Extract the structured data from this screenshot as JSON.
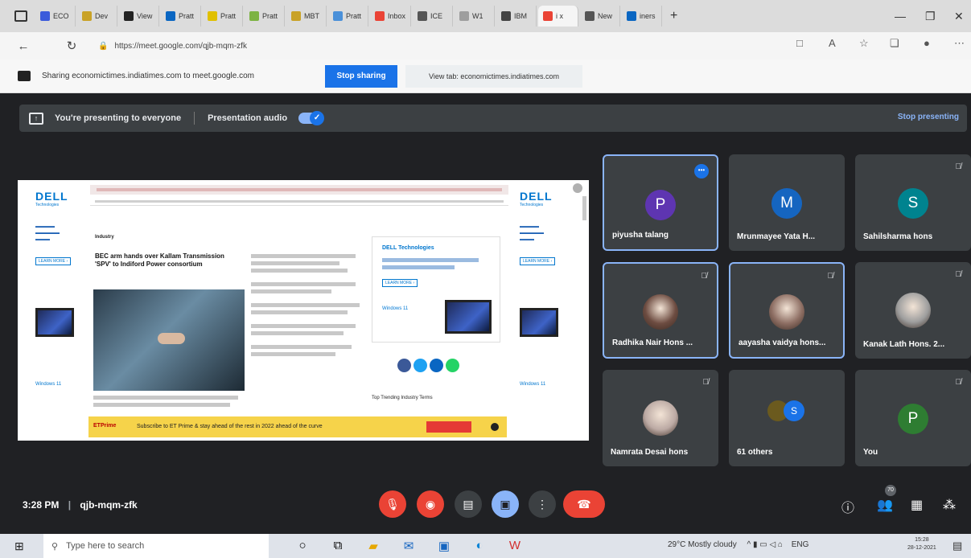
{
  "browser": {
    "tabs": [
      {
        "label": "ECO",
        "color": "#3b5bdb"
      },
      {
        "label": "Dev",
        "color": "#c9a227"
      },
      {
        "label": "View",
        "color": "#222222"
      },
      {
        "label": "Pratt",
        "color": "#0a66c2"
      },
      {
        "label": "Pratt",
        "color": "#e0c000"
      },
      {
        "label": "Pratt",
        "color": "#7cb342"
      },
      {
        "label": "MBT",
        "color": "#c9a227"
      },
      {
        "label": "Pratt",
        "color": "#4a90d9"
      },
      {
        "label": "Inbox",
        "color": "#ea4335"
      },
      {
        "label": "ICE",
        "color": "#555555"
      },
      {
        "label": "W1",
        "color": "#9e9e9e"
      },
      {
        "label": "IBM",
        "color": "#444444"
      },
      {
        "label": "i x",
        "color": "#ea4335",
        "active": true
      },
      {
        "label": "New",
        "color": "#555555"
      },
      {
        "label": "iners",
        "color": "#0a66c2"
      }
    ],
    "url": "https://meet.google.com/qjb-mqm-zfk",
    "window_controls": {
      "minimize": "—",
      "restore": "❐",
      "close": "✕"
    }
  },
  "sharebar": {
    "text": "Sharing economictimes.indiatimes.com to meet.google.com",
    "stop_label": "Stop sharing",
    "view_label": "View tab: economictimes.indiatimes.com"
  },
  "presenting": {
    "text": "You're presenting to everyone",
    "audio_label": "Presentation audio",
    "stop_label": "Stop presenting"
  },
  "shared_page": {
    "brand": "DELL",
    "brand_sub": "Technologies",
    "section": "Industry",
    "headline": "BEC arm hands over Kallam Transmission 'SPV' to Indiford Power consortium",
    "ad_title": "DELL Technologies",
    "ad_os": "Windows 11",
    "learn_more": "LEARN MORE ›",
    "trending": "Top Trending Industry Terms",
    "banner_brand": "ETPrime",
    "banner_text": "Subscribe to ET Prime & stay ahead of the rest in 2022 ahead of the curve"
  },
  "participants": [
    {
      "name": "piyusha talang",
      "initial": "P",
      "color": "#5e35b1",
      "type": "initial",
      "speaking": true,
      "more": true
    },
    {
      "name": "Mrunmayee Yata H...",
      "initial": "M",
      "color": "#1565c0",
      "type": "initial",
      "speaking": false
    },
    {
      "name": "Sahilsharma hons",
      "initial": "S",
      "color": "#00838f",
      "type": "initial",
      "speaking": false,
      "muted": true
    },
    {
      "name": "Radhika Nair Hons ...",
      "type": "photo",
      "color": "#6d4c41",
      "speaking": true,
      "muted": true
    },
    {
      "name": "aayasha vaidya hons...",
      "type": "photo",
      "color": "#8d6e63",
      "speaking": true,
      "muted": true
    },
    {
      "name": "Kanak Lath Hons. 2...",
      "type": "photo",
      "color": "#9e9e9e",
      "speaking": false,
      "muted": true
    },
    {
      "name": "Namrata Desai hons",
      "type": "photo",
      "color": "#bcaaa4",
      "speaking": false,
      "muted": true
    },
    {
      "name": "61 others",
      "type": "group",
      "color": "#1a73e8",
      "speaking": false
    },
    {
      "name": "You",
      "initial": "P",
      "color": "#2e7d32",
      "type": "initial",
      "speaking": false,
      "muted": true
    }
  ],
  "meeting": {
    "time": "3:28 PM",
    "code": "qjb-mqm-zfk",
    "participants_badge": "70"
  },
  "taskbar": {
    "search_placeholder": "Type here to search",
    "weather": "29°C  Mostly cloudy",
    "lang": "ENG",
    "time": "15:28",
    "date": "28-12-2021"
  }
}
